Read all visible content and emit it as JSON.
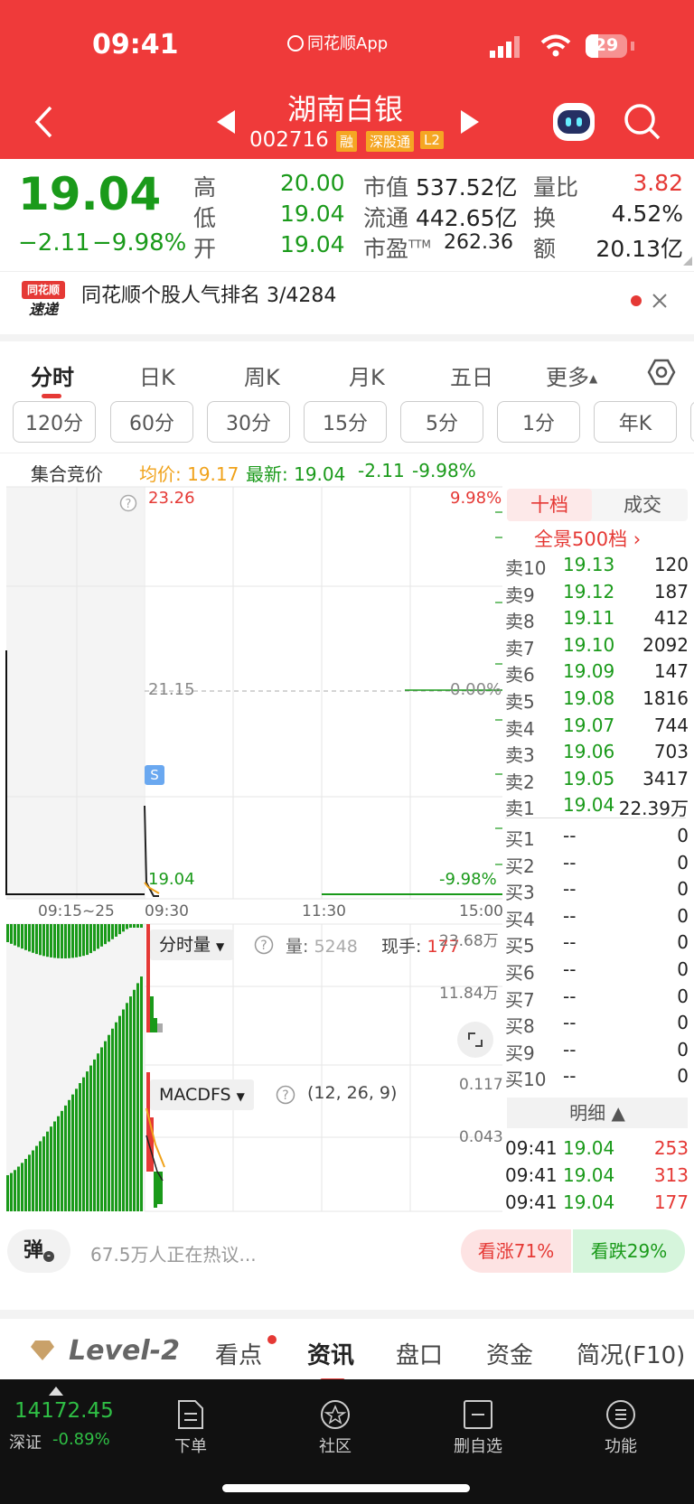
{
  "status_bar": {
    "time": "09:41",
    "app_name": "同花顺App",
    "battery": "29"
  },
  "header": {
    "stock_name": "湖南白银",
    "stock_code": "002716",
    "badges": [
      "融",
      "深股通",
      "L2"
    ]
  },
  "quote": {
    "price": "19.04",
    "change": "−2.11",
    "change_pct": "−9.98%",
    "stats": [
      {
        "label": "高",
        "value": "20.00",
        "color": "#1a9a1a"
      },
      {
        "label": "低",
        "value": "19.04",
        "color": "#1a9a1a"
      },
      {
        "label": "开",
        "value": "19.04",
        "color": "#1a9a1a"
      },
      {
        "label": "市值",
        "value": "537.52亿"
      },
      {
        "label": "流通",
        "value": "442.65亿"
      },
      {
        "label": "市盈",
        "sup": "TTM",
        "value": "262.36"
      },
      {
        "label": "量比",
        "value": "3.82",
        "color": "#e53935"
      },
      {
        "label": "换",
        "value": "4.52%"
      },
      {
        "label": "额",
        "value": "20.13亿"
      }
    ]
  },
  "rank_banner": {
    "logo_top": "同花顺",
    "logo_bottom": "速递",
    "text": "同花顺个股人气排名 3/4284"
  },
  "period_tabs": [
    "分时",
    "日K",
    "周K",
    "月K",
    "五日",
    "更多"
  ],
  "active_period": "分时",
  "interval_chips": [
    "120分",
    "60分",
    "30分",
    "15分",
    "5分",
    "1分",
    "年K"
  ],
  "info_line": {
    "auction": "集合竞价",
    "avg": "均价: 19.17",
    "latest": "最新: 19.04",
    "chg": "-2.11",
    "pct": "-9.98%"
  },
  "chart": {
    "price_top": "23.26",
    "pct_top": "9.98%",
    "price_mid": "21.15",
    "pct_mid": "0.00%",
    "price_bot": "19.04",
    "pct_bot": "-9.98%",
    "s_marker": "S",
    "time_labels": [
      "09:15~25",
      "09:30",
      "11:30",
      "15:00"
    ],
    "volume_indicator": "分时量",
    "vol_label": "量:",
    "vol_value": "5248",
    "hand_label": "现手:",
    "hand_value": "177",
    "vol_top": "23.68万",
    "vol_mid": "11.84万",
    "macd_indicator": "MACDFS",
    "macd_params": "(12, 26, 9)",
    "macd_top": "0.117",
    "macd_mid": "0.043"
  },
  "orderbook": {
    "tabs": [
      "十档",
      "成交"
    ],
    "panorama": "全景500档 ›",
    "asks": [
      {
        "label": "卖10",
        "price": "19.13",
        "vol": "120"
      },
      {
        "label": "卖9",
        "price": "19.12",
        "vol": "187"
      },
      {
        "label": "卖8",
        "price": "19.11",
        "vol": "412"
      },
      {
        "label": "卖7",
        "price": "19.10",
        "vol": "2092"
      },
      {
        "label": "卖6",
        "price": "19.09",
        "vol": "147"
      },
      {
        "label": "卖5",
        "price": "19.08",
        "vol": "1816"
      },
      {
        "label": "卖4",
        "price": "19.07",
        "vol": "744"
      },
      {
        "label": "卖3",
        "price": "19.06",
        "vol": "703"
      },
      {
        "label": "卖2",
        "price": "19.05",
        "vol": "3417"
      },
      {
        "label": "卖1",
        "price": "19.04",
        "vol": "22.39万"
      }
    ],
    "bids": [
      {
        "label": "买1",
        "price": "--",
        "vol": "0"
      },
      {
        "label": "买2",
        "price": "--",
        "vol": "0"
      },
      {
        "label": "买3",
        "price": "--",
        "vol": "0"
      },
      {
        "label": "买4",
        "price": "--",
        "vol": "0"
      },
      {
        "label": "买5",
        "price": "--",
        "vol": "0"
      },
      {
        "label": "买6",
        "price": "--",
        "vol": "0"
      },
      {
        "label": "买7",
        "price": "--",
        "vol": "0"
      },
      {
        "label": "买8",
        "price": "--",
        "vol": "0"
      },
      {
        "label": "买9",
        "price": "--",
        "vol": "0"
      },
      {
        "label": "买10",
        "price": "--",
        "vol": "0"
      }
    ],
    "detail_label": "明细 ▲",
    "trades": [
      {
        "time": "09:41",
        "price": "19.04",
        "vol": "253"
      },
      {
        "time": "09:41",
        "price": "19.04",
        "vol": "313"
      },
      {
        "time": "09:41",
        "price": "19.04",
        "vol": "177"
      }
    ]
  },
  "discussion": {
    "bullet": "弹",
    "text": "67.5万人正在热议...",
    "up": "看涨71%",
    "down": "看跌29%"
  },
  "bottom_tabs": [
    "Level-2",
    "看点",
    "资讯",
    "盘口",
    "资金",
    "简况(F10)"
  ],
  "active_bottom_tab": "资讯",
  "nav": {
    "index_value": "14172.45",
    "index_name": "深证",
    "index_pct": "-0.89%",
    "items": [
      {
        "label": "下单"
      },
      {
        "label": "社区"
      },
      {
        "label": "删自选"
      },
      {
        "label": "功能"
      }
    ]
  }
}
